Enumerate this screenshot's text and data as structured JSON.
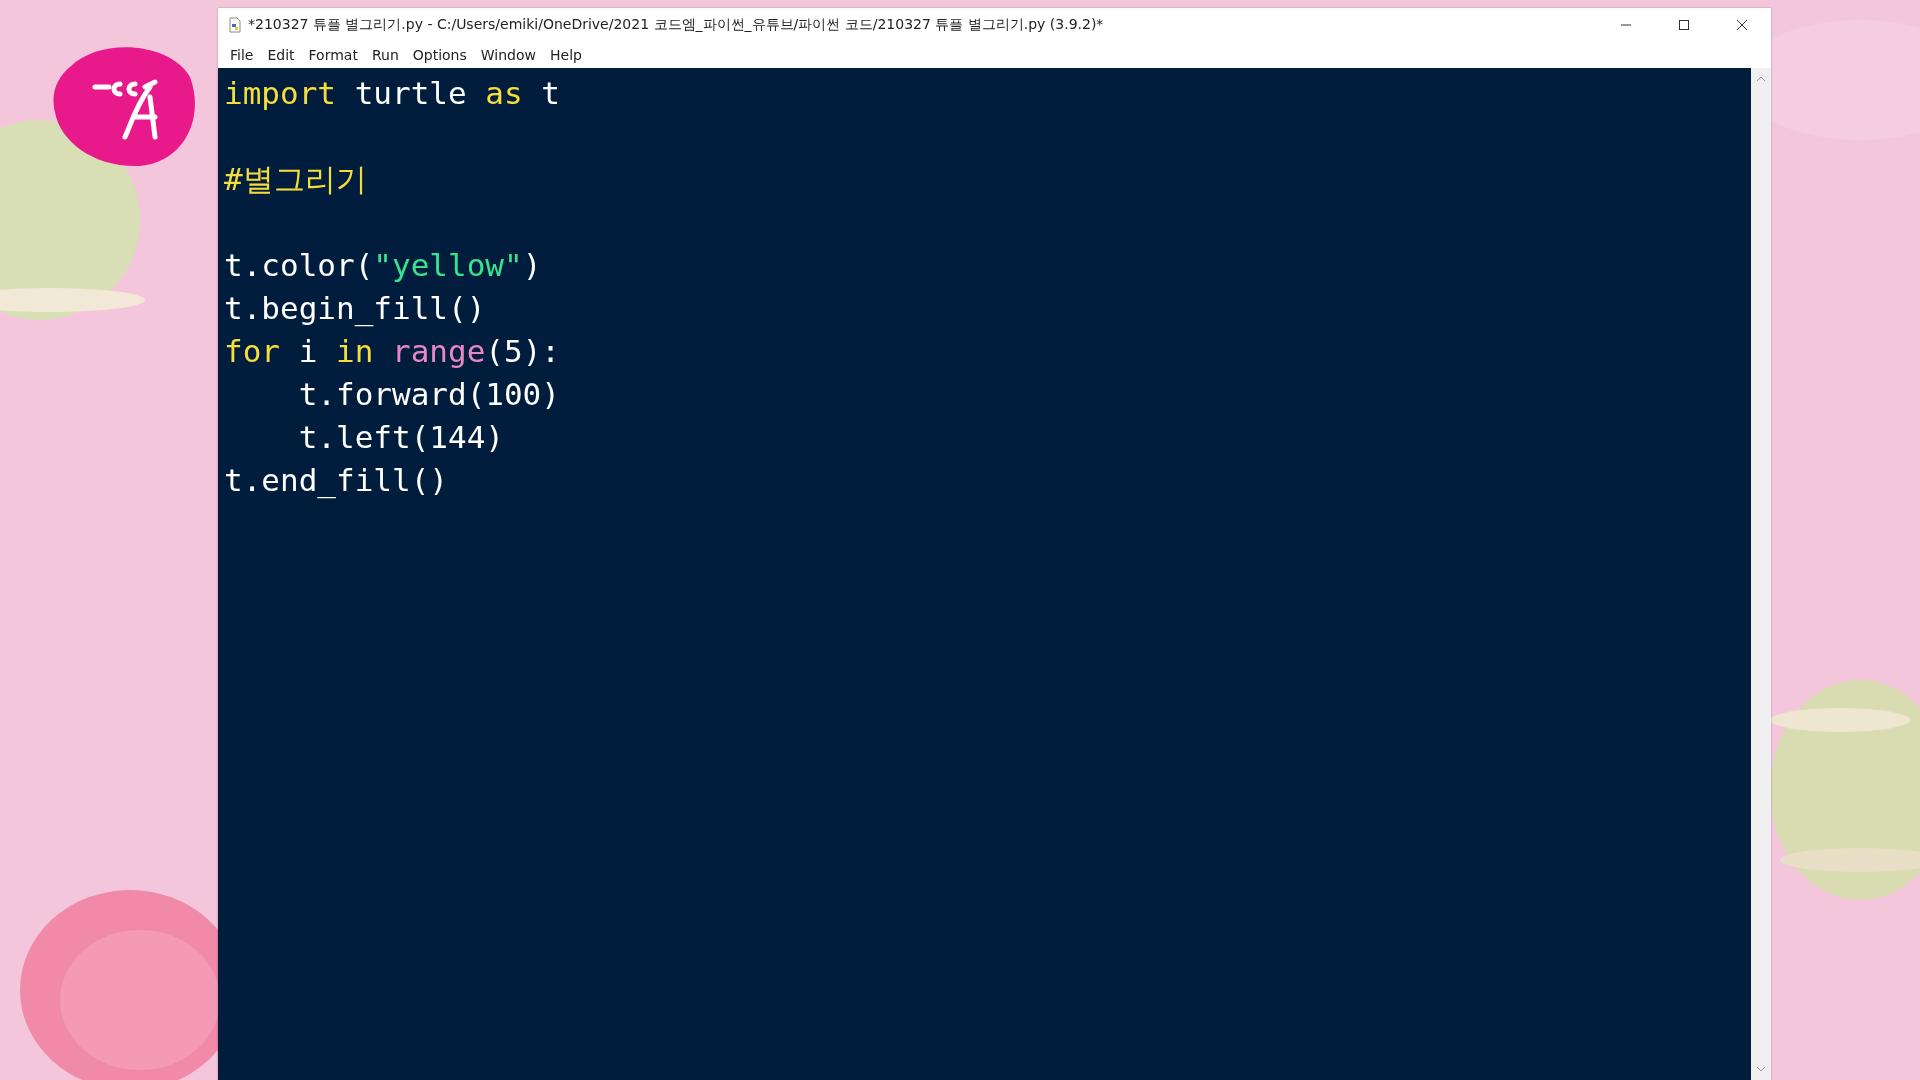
{
  "window": {
    "title": "*210327 튜플 별그리기.py - C:/Users/emiki/OneDrive/2021 코드엠_파이썬_유튜브/파이썬 코드/210327 튜플 별그리기.py (3.9.2)*"
  },
  "menu": [
    "File",
    "Edit",
    "Format",
    "Run",
    "Options",
    "Window",
    "Help"
  ],
  "editor": {
    "lines": [
      {
        "kind": "code",
        "tokens": [
          {
            "kind": "keyword",
            "text": "import"
          },
          {
            "kind": "plain",
            "text": " turtle "
          },
          {
            "kind": "keyword",
            "text": "as"
          },
          {
            "kind": "plain",
            "text": " t"
          }
        ]
      },
      {
        "kind": "blank"
      },
      {
        "kind": "code",
        "tokens": [
          {
            "kind": "comment",
            "text": "#별그리기"
          }
        ]
      },
      {
        "kind": "blank"
      },
      {
        "kind": "code",
        "tokens": [
          {
            "kind": "plain",
            "text": "t.color("
          },
          {
            "kind": "string",
            "text": "\"yellow\""
          },
          {
            "kind": "plain",
            "text": ")"
          }
        ]
      },
      {
        "kind": "code",
        "tokens": [
          {
            "kind": "plain",
            "text": "t.begin_fill()"
          }
        ]
      },
      {
        "kind": "code",
        "tokens": [
          {
            "kind": "keyword",
            "text": "for"
          },
          {
            "kind": "plain",
            "text": " i "
          },
          {
            "kind": "keyword",
            "text": "in "
          },
          {
            "kind": "builtin",
            "text": "range"
          },
          {
            "kind": "plain",
            "text": "(5):"
          }
        ]
      },
      {
        "kind": "code",
        "tokens": [
          {
            "kind": "plain",
            "text": "    t.forward(100)"
          }
        ]
      },
      {
        "kind": "code",
        "tokens": [
          {
            "kind": "plain",
            "text": "    t.left(144)"
          }
        ]
      },
      {
        "kind": "code",
        "tokens": [
          {
            "kind": "plain",
            "text": "t.end_fill()"
          }
        ]
      }
    ]
  }
}
